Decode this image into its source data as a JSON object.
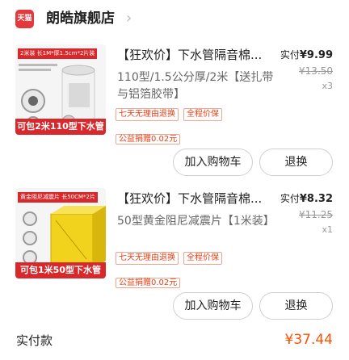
{
  "store": {
    "name": "朗皓旗舰店",
    "logo_text": "天猫"
  },
  "items": [
    {
      "thumb_tag": "2米装 长1M*厚1.5cm*2片装",
      "thumb_banner": "可包2米110型下水管",
      "title": "【狂欢价】下水管隔音棉...",
      "spec": "110型/1.5公分厚/2米【送扎带与铝箔胶带】",
      "paid_label": "实付",
      "paid_amount": "¥9.99",
      "orig_price": "¥13.50",
      "qty": "x3",
      "tags": [
        "七天无理由退换",
        "全程价保"
      ],
      "charity": "公益捐赠0.02元",
      "cart_label": "加入购物车",
      "refund_label": "退换"
    },
    {
      "thumb_tag": "黄金阻尼减震片 长50CM*2片",
      "thumb_banner": "可包1米50型下水管",
      "title": "【狂欢价】下水管隔音棉...",
      "spec": "50型黄金阻尼减震片【1米装】",
      "paid_label": "实付",
      "paid_amount": "¥8.32",
      "orig_price": "¥11.25",
      "qty": "x1",
      "tags": [
        "七天无理由退换",
        "全程价保"
      ],
      "charity": "公益捐赠0.02元",
      "cart_label": "加入购物车",
      "refund_label": "退换"
    }
  ],
  "total": {
    "label": "实付款",
    "amount": "¥37.44"
  },
  "colors": {
    "accent": "#ff5000",
    "tmall_red": "#e4393c",
    "tag_red": "#e5411b"
  }
}
